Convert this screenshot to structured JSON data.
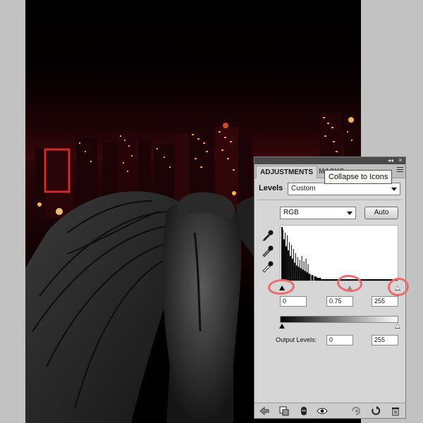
{
  "panel": {
    "tabs": [
      {
        "label": "ADJUSTMENTS",
        "active": true
      },
      {
        "label": "MASKS",
        "active": false
      }
    ],
    "tooltip": "Collapse to Icons",
    "adjustment_label": "Levels",
    "preset_value": "Custom",
    "channel_value": "RGB",
    "auto_label": "Auto",
    "input_levels": {
      "black": "0",
      "gamma": "0.75",
      "white": "255"
    },
    "output_label": "Output Levels:",
    "output_levels": {
      "black": "0",
      "white": "255"
    }
  },
  "colors": {
    "panel_bg": "#d6d6d6",
    "annotation": "#f06a6a",
    "city_lights": "#ff8a2a"
  },
  "icons": [
    "eyedropper-black-icon",
    "eyedropper-gray-icon",
    "eyedropper-white-icon",
    "back-arrow-icon",
    "clip-layer-icon",
    "visibility-icon",
    "eye-icon",
    "previous-state-icon",
    "reset-icon",
    "trash-icon",
    "collapse-icon",
    "close-icon",
    "panel-menu-icon"
  ]
}
